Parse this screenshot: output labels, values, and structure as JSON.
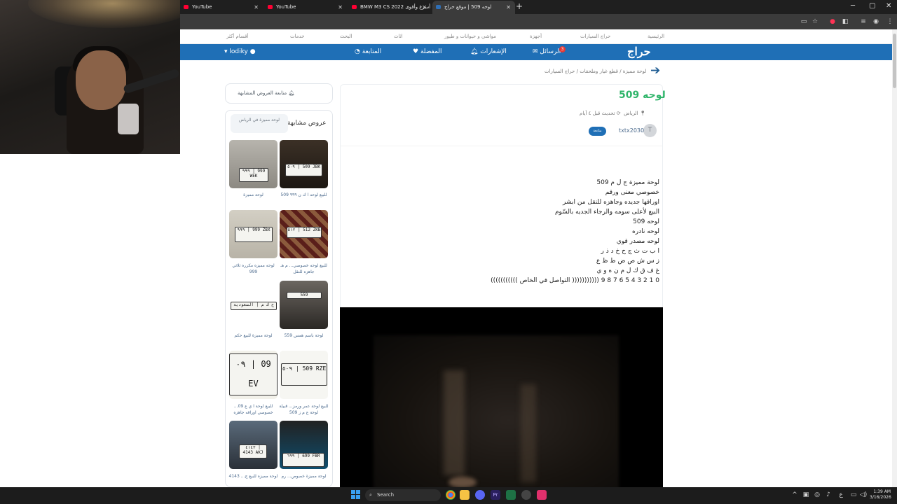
{
  "tabs": [
    {
      "title": "YouTube",
      "icon": "youtube-icon",
      "active": false
    },
    {
      "title": "YouTube",
      "icon": "youtube-icon",
      "active": false
    },
    {
      "title": "BMW M3 CS 2022 أسرع وأقوى",
      "icon": "youtube-icon",
      "active": false
    },
    {
      "title": "لوحه 509 | موقع حراج",
      "icon": "haraj-icon",
      "active": true
    }
  ],
  "new_tab": "+",
  "window_controls": {
    "minimize": "─",
    "maximize": "▢",
    "close": "✕"
  },
  "top_nav": [
    {
      "label": "الرئيسية",
      "icon": "home-icon"
    },
    {
      "label": "حراج السيارات",
      "icon": "car-icon"
    },
    {
      "label": "أجهزة",
      "icon": "device-icon"
    },
    {
      "label": "مواشي و حيوانات و طيور",
      "icon": "pet-icon"
    },
    {
      "label": "اثاث",
      "icon": "sofa-icon"
    },
    {
      "label": "البحث",
      "icon": "search-icon"
    },
    {
      "label": "خدمات",
      "icon": ""
    },
    {
      "label": "أقسام أكثر",
      "icon": "grid-icon"
    }
  ],
  "blue_bar": {
    "logo": "حراج",
    "messages": "الرسائل",
    "messages_badge": "3",
    "notifications": "الإشعارات",
    "favorites": "المفضلة",
    "following": "المتابعة",
    "user": "lodiky"
  },
  "breadcrumb": [
    "حراج السيارات",
    "قطع غيار وملحقات",
    "لوحة مميزة"
  ],
  "listing": {
    "title": "لوحه 509",
    "city": "الرياض",
    "updated": "تحديث قبل ٤ أيام",
    "seller_initial": "T",
    "seller": "txtx2030",
    "follow": "متابعة",
    "description": [
      "لوحة مميزة ج ل م 509",
      "خصوصي معنى ورقم",
      "اوراقها جديده وجاهزه للنقل من ابشر",
      "البيع لأعلى سومه والرجاء الجديه بالسّوم",
      "لوحه 509",
      "لوحه نادره",
      "لوحه مصدر قوي",
      "ا ب ت ث ج ح خ د ذ ر",
      "ز س ش ص ض ط ظ ع",
      "غ ف ق ك ل م ن ه و ي",
      "0 1 2 3 4 5 6 7 8 9 ((((((((((( التواصل في الخاص )))))))))))"
    ]
  },
  "sidebar": {
    "follow_similar": "متابعة العروض المشابهة",
    "similar_title": "عروض مشابهة",
    "city_chip": "لوحة مميزة في الرياض",
    "items": [
      {
        "caption": "للبيع لوحه ا ك ن ٩٩٩ 509",
        "plate": "٥٠٩ | 509 JBK"
      },
      {
        "caption": "لوحة مميزة",
        "plate": "٩٩٩ | 999 WEK"
      },
      {
        "caption": "للبيع لوحه خصوصي... م هـ جاهزه للنقل",
        "plate": "٥١٢ | 512 ZKB"
      },
      {
        "caption": "لوحه مميزه مكرره ثلاثي 999",
        "plate": "٩٩٩ | 999 ZBX"
      },
      {
        "caption": "لوحة باسم همس 559",
        "plate": "559"
      },
      {
        "caption": "لوحة مميزة للبيع حكم",
        "plate": "ح ك م | السعودية"
      },
      {
        "caption": "للبيع لوحة عمر ورمز... قبيلة لوحة ع م ز 509",
        "plate": "٥٠٩ | 509 RZE"
      },
      {
        "caption": "للبيع لوحة ا ي ع 09... خصوصي اوراقه جاهزه",
        "plate": "٠٩ | 09 EV"
      },
      {
        "caption": "لوحة مميزة خصوص... رم",
        "plate": "٦٩٩ | 699 FBR"
      },
      {
        "caption": "لوحة مميزه للبيع ج... 4143",
        "plate": "٤١٤٣ | 4143 AKJ"
      }
    ]
  },
  "taskbar": {
    "search": "Search",
    "time": "1:39 AM",
    "date": "3/16/2026",
    "lang": "ع"
  },
  "colors": {
    "brand_blue": "#1f6fb6",
    "title_green": "#2fb56a",
    "badge_red": "#e53935"
  }
}
